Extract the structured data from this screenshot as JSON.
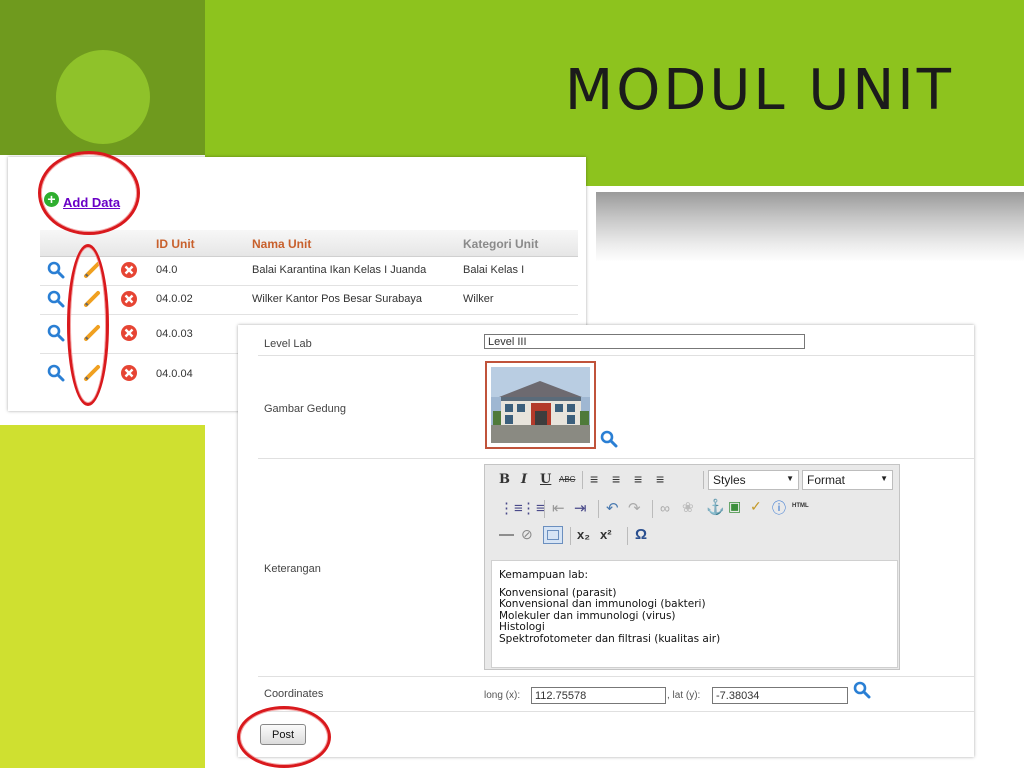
{
  "slide": {
    "title": "MODUL UNIT"
  },
  "unit_table": {
    "add_data_label": "Add Data",
    "columns": [
      "ID Unit",
      "Nama Unit",
      "Kategori Unit"
    ],
    "rows": [
      {
        "id": "04.0",
        "nama": "Balai Karantina Ikan Kelas I Juanda",
        "kategori": "Balai Kelas I"
      },
      {
        "id": "04.0.02",
        "nama": "Wilker Kantor Pos Besar Surabaya",
        "kategori": "Wilker"
      },
      {
        "id": "04.0.03",
        "nama": "",
        "kategori": ""
      },
      {
        "id": "04.0.04",
        "nama": "",
        "kategori": ""
      }
    ],
    "row_action_icons": [
      "search-icon",
      "pencil-icon",
      "delete-icon"
    ]
  },
  "unit_form": {
    "level_lab": {
      "label": "Level Lab",
      "value": "Level III"
    },
    "gambar_gedung": {
      "label": "Gambar Gedung"
    },
    "keterangan": {
      "label": "Keterangan",
      "toolbar": {
        "bold": "B",
        "italic": "I",
        "underline": "U",
        "strike": "ABC",
        "styles": "Styles",
        "format": "Format",
        "html": "HTML",
        "subscript": "x₂",
        "superscript": "x²",
        "omega": "Ω"
      },
      "content_lines": [
        "Kemampuan lab:",
        "",
        "Konvensional (parasit)",
        "Konvensional dan immunologi (bakteri)",
        "Molekuler dan immunologi (virus)",
        "Histologi",
        "Spektrofotometer dan filtrasi (kualitas air)"
      ]
    },
    "coordinates": {
      "label": "Coordinates",
      "long_label": "long (x):",
      "long_value": "112.75578",
      "lat_label": ", lat (y):",
      "lat_value": "-7.38034"
    },
    "post_label": "Post"
  },
  "colors": {
    "slide_green": "#8dc31e",
    "slide_dark_green": "#6f9a1e",
    "slide_lime": "#cfe030",
    "header_orange": "#c8602c",
    "link_purple": "#6a00c6",
    "highlight_red": "#d9191d"
  }
}
